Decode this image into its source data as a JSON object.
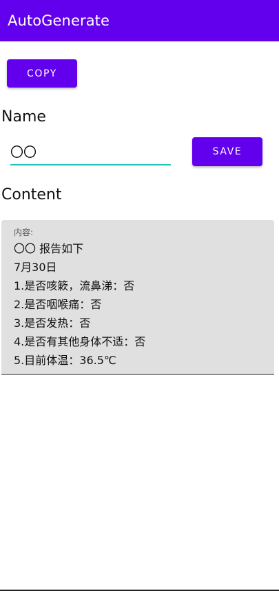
{
  "app_bar": {
    "title": "AutoGenerate"
  },
  "actions": {
    "copy_label": "COPY",
    "save_label": "SAVE"
  },
  "name": {
    "label": "Name",
    "value": "〇〇"
  },
  "content": {
    "label": "Content",
    "hint": "内容:",
    "lines": "〇〇 报告如下\n7月30日\n1.是否咳簌，流鼻涕：否\n2.是否咽喉痛：否\n3.是否发热：否\n4.是否有其他身体不适：否\n5.目前体温：36.5℃"
  },
  "colors": {
    "primary": "#6200ee",
    "input_underline": "#26c6bf",
    "content_background": "#e0e0e0"
  }
}
